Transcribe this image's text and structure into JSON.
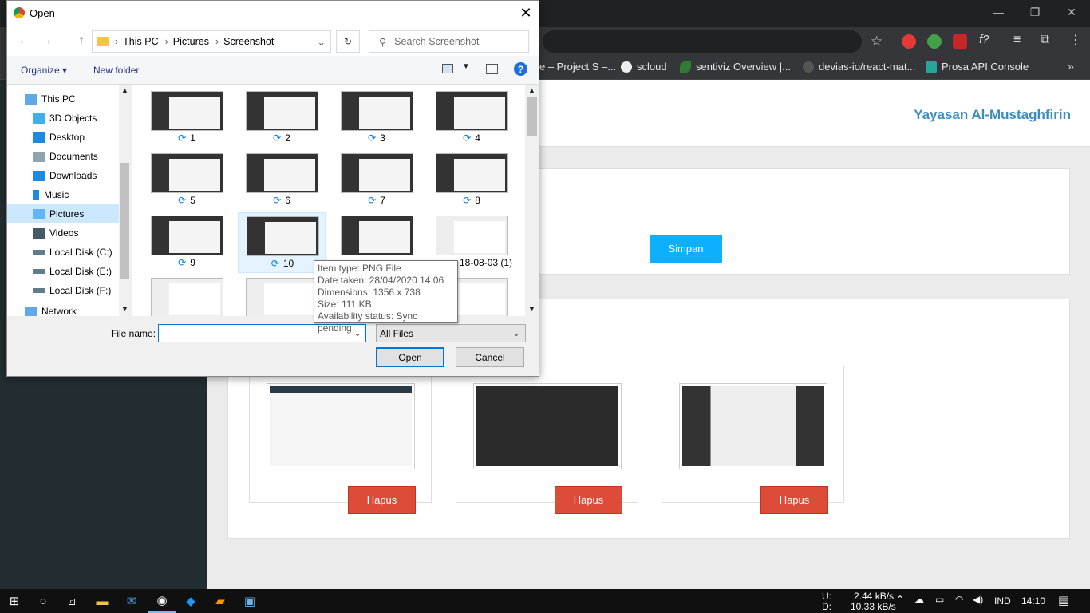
{
  "dialog": {
    "title": "Open",
    "path": [
      "This PC",
      "Pictures",
      "Screenshot"
    ],
    "search_placeholder": "Search Screenshot",
    "commands": {
      "organize": "Organize ▾",
      "new_folder": "New folder"
    },
    "nav_items": [
      "This PC",
      "3D Objects",
      "Desktop",
      "Documents",
      "Downloads",
      "Music",
      "Pictures",
      "Videos",
      "Local Disk (C:)",
      "Local Disk (E:)",
      "Local Disk (F:)",
      "Network"
    ],
    "files": [
      "1",
      "2",
      "3",
      "4",
      "5",
      "6",
      "7",
      "8",
      "9",
      "10",
      "18-08-03 (1)",
      "",
      "",
      "",
      ""
    ],
    "tooltip": {
      "type": "Item type: PNG File",
      "date": "Date taken: 28/04/2020 14:06",
      "dims": "Dimensions: 1356 x 738",
      "size": "Size: 111 KB",
      "status": "Availability status: Sync pending"
    },
    "file_name_label": "File name:",
    "file_name_value": "",
    "filter": "All Files",
    "open_btn": "Open",
    "cancel_btn": "Cancel"
  },
  "bookmarks": [
    "e – Project S –...",
    "scloud",
    "sentiviz Overview |...",
    "devias-io/react-mat...",
    "Prosa API Console"
  ],
  "page": {
    "org": "Yayasan Al-Mustaghfirin",
    "save_btn": "Simpan",
    "delete_btn": "Hapus"
  },
  "taskbar": {
    "up": "U:",
    "down": "D:",
    "up_speed": "2.44 kB/s",
    "down_speed": "10.33 kB/s",
    "lang": "IND",
    "time": "14:10"
  },
  "colors": {
    "accent": "#3c8dbc",
    "save": "#0cb0ff",
    "danger": "#dd4b39"
  }
}
